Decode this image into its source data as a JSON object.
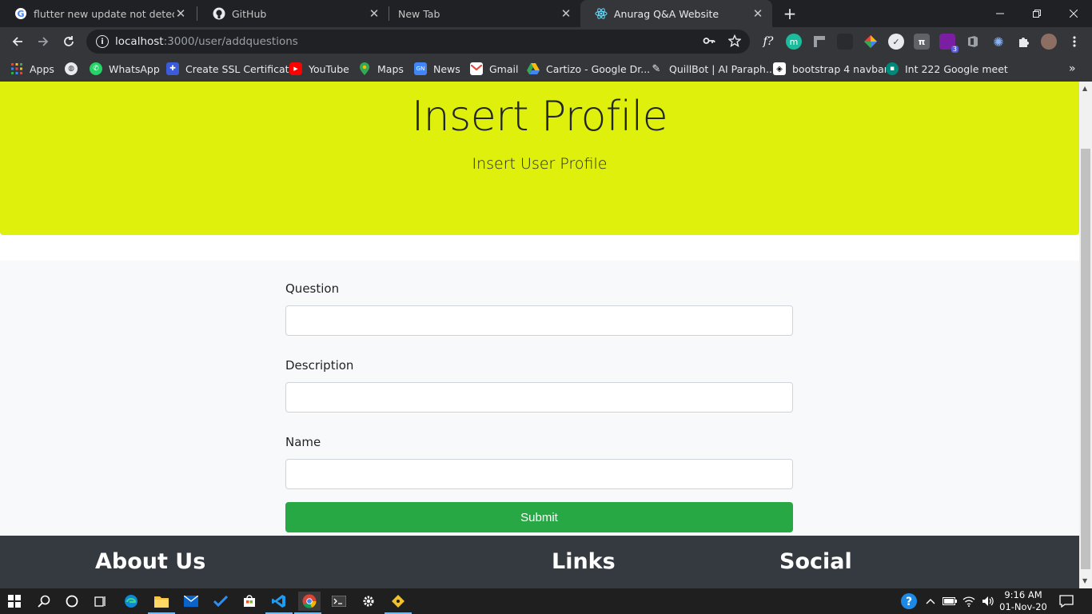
{
  "browser": {
    "tabs": [
      {
        "title": "flutter new update not detected",
        "icon": "google-icon",
        "active": false
      },
      {
        "title": "GitHub",
        "icon": "github-icon",
        "active": false
      },
      {
        "title": "New Tab",
        "icon": "",
        "active": false
      },
      {
        "title": "Anurag Q&A Website",
        "icon": "react-icon",
        "active": true
      }
    ],
    "close_glyph": "✕",
    "new_tab_glyph": "+",
    "url_host": "localhost",
    "url_path": ":3000/user/addquestions",
    "extension_badge": "3"
  },
  "bookmarks": [
    {
      "label": "Apps",
      "icon": "apps-grid-icon"
    },
    {
      "label": "",
      "icon": "globe-icon"
    },
    {
      "label": "WhatsApp",
      "icon": "whatsapp-icon"
    },
    {
      "label": "Create SSL Certificate",
      "icon": "puzzle-icon"
    },
    {
      "label": "YouTube",
      "icon": "youtube-icon"
    },
    {
      "label": "Maps",
      "icon": "maps-pin-icon"
    },
    {
      "label": "News",
      "icon": "news-icon"
    },
    {
      "label": "Gmail",
      "icon": "gmail-icon"
    },
    {
      "label": "Cartizo - Google Dr...",
      "icon": "drive-icon"
    },
    {
      "label": "QuillBot | AI Paraph...",
      "icon": "quill-icon"
    },
    {
      "label": "bootstrap 4 navbar",
      "icon": "codepen-icon"
    },
    {
      "label": "Int 222 Google meet",
      "icon": "meet-icon"
    }
  ],
  "page": {
    "jumbotron": {
      "title": "Insert Profile",
      "subtitle": "Insert User Profile"
    },
    "form": {
      "question_label": "Question",
      "question_value": "",
      "description_label": "Description",
      "description_value": "",
      "name_label": "Name",
      "name_value": "",
      "submit_label": "Submit"
    },
    "footer": {
      "about_title": "About Us",
      "links_title": "Links",
      "social_title": "Social"
    }
  },
  "taskbar": {
    "time": "9:16 AM",
    "date": "01-Nov-20"
  },
  "colors": {
    "jumbotron_bg": "#def00b",
    "submit_bg": "#28a745",
    "footer_bg": "#343a40"
  }
}
